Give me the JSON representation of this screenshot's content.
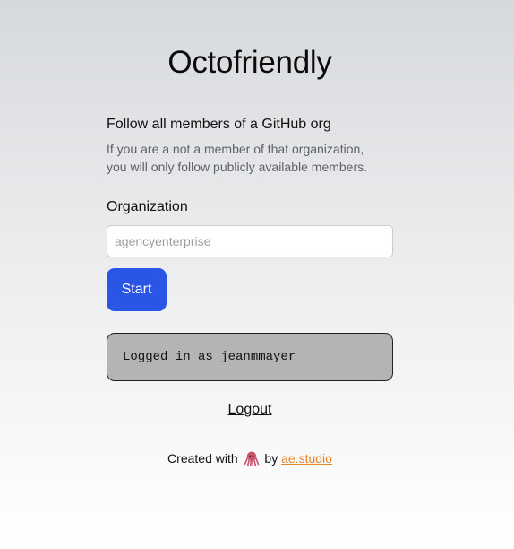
{
  "app": {
    "title": "Octofriendly"
  },
  "intro": {
    "heading": "Follow all members of a GitHub org",
    "description_line1": "If you are a not a member of that organization,",
    "description_line2": "you will only follow publicly available members."
  },
  "form": {
    "org_label": "Organization",
    "org_value": "",
    "org_placeholder": "agencyenterprise",
    "start_label": "Start"
  },
  "status": {
    "text": "Logged in as jeanmmayer"
  },
  "auth": {
    "logout_label": "Logout"
  },
  "footer": {
    "created_with": "Created with",
    "icon": "octopus-icon",
    "by": "by",
    "link_text": "ae.studio"
  },
  "colors": {
    "accent": "#2a55e5",
    "link": "#e8852b",
    "status_bg": "#b4b4b4"
  }
}
